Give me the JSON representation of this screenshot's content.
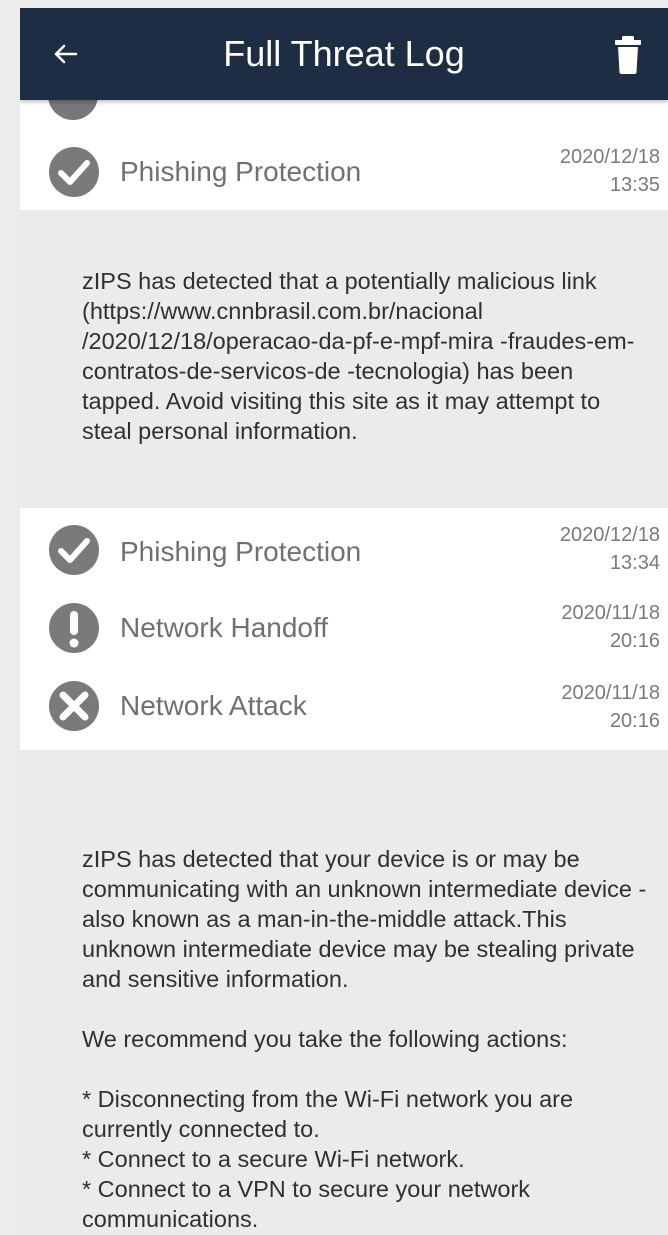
{
  "appbar": {
    "title": "Full Threat Log",
    "back_icon": "arrow-left-icon",
    "delete_icon": "trash-icon",
    "background": "#1f2d44"
  },
  "threats": [
    {
      "name": "Phishing Protection",
      "date": "2020/12/18",
      "time": "13:35",
      "status_icon": "check-circle-icon",
      "detail": [
        "zIPS has detected that a potentially malicious link (https://www.cnnbrasil.com.br/nacional /2020/12/18/operacao-da-pf-e-mpf-mira -fraudes-em-contratos-de-servicos-de -tecnologia) has been tapped. Avoid visiting this site as it may attempt to steal personal information."
      ]
    },
    {
      "name": "Phishing Protection",
      "date": "2020/12/18",
      "time": "13:34",
      "status_icon": "check-circle-icon"
    },
    {
      "name": "Network Handoff",
      "date": "2020/11/18",
      "time": "20:16",
      "status_icon": "exclamation-circle-icon"
    },
    {
      "name": "Network Attack",
      "date": "2020/11/18",
      "time": "20:16",
      "status_icon": "x-circle-icon",
      "detail": [
        "zIPS has detected that your device is or may be communicating with an unknown intermediate device - also known as a man-in-the-middle attack.This unknown intermediate device may be stealing private and sensitive information.",
        "We recommend you take the following actions:",
        "* Disconnecting from the Wi-Fi network you are currently connected to.",
        "* Connect to a secure Wi-Fi network.",
        "* Connect to a VPN to secure your network communications."
      ]
    }
  ],
  "colors": {
    "icon_gray": "#7a7a7a",
    "detail_bg": "#ebebeb"
  }
}
